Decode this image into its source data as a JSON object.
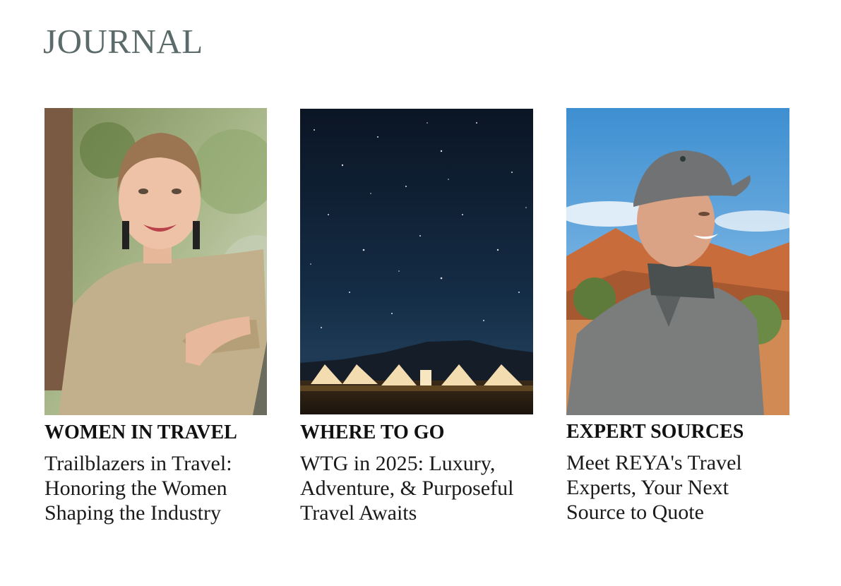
{
  "page": {
    "title": "JOURNAL"
  },
  "articles": [
    {
      "category": "WOMEN IN TRAVEL",
      "headline": "Trailblazers in Travel: Honoring the Women Shaping the Industry"
    },
    {
      "category": "WHERE TO GO",
      "headline": "WTG in 2025: Luxury, Adventure, & Purposeful Travel Awaits"
    },
    {
      "category": "EXPERT SOURCES",
      "headline": "Meet REYA's Travel Experts, Your Next Source to Quote"
    }
  ]
}
